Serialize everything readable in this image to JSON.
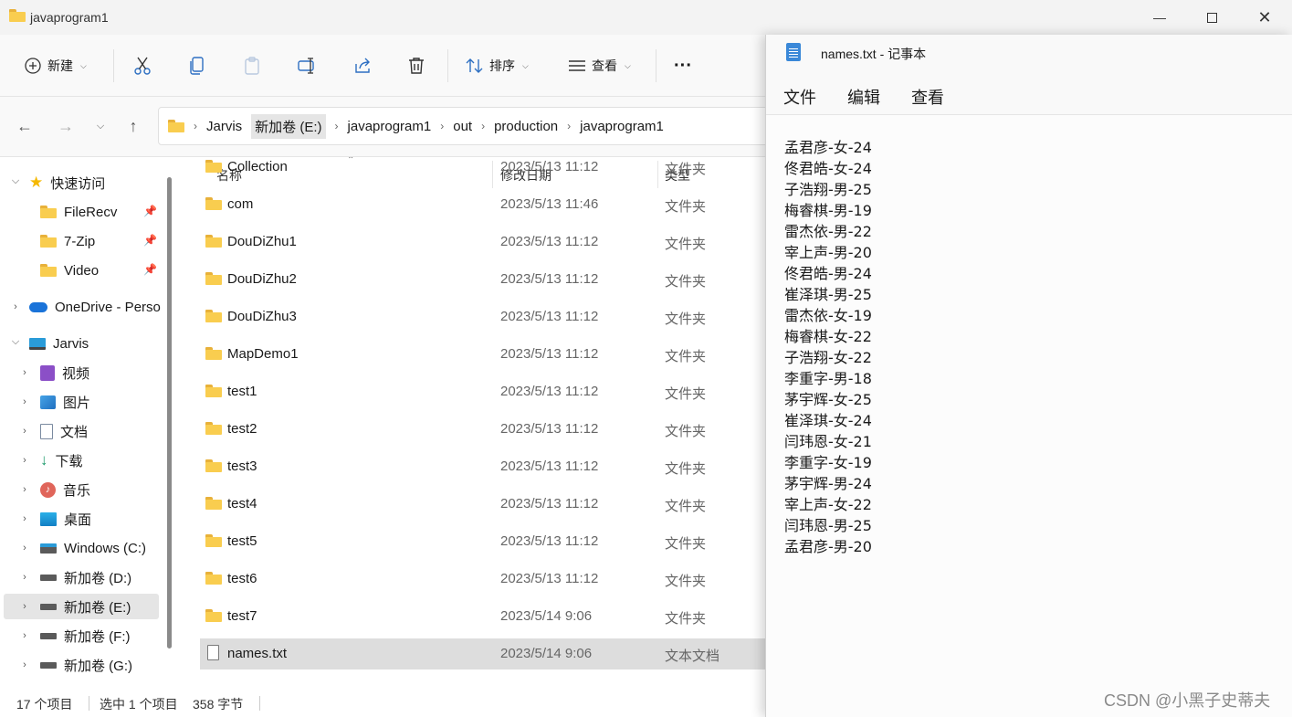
{
  "explorer": {
    "title": "javaprogram1",
    "toolbar": {
      "new_label": "新建",
      "sort_label": "排序",
      "view_label": "查看",
      "more_label": "···"
    },
    "breadcrumb": [
      "Jarvis",
      "新加卷 (E:)",
      "javaprogram1",
      "out",
      "production",
      "javaprogram1"
    ],
    "sidebar": {
      "quick_access": "快速访问",
      "pinned": [
        "FileRecv",
        "7-Zip",
        "Video"
      ],
      "onedrive": "OneDrive - Perso",
      "this_pc": "Jarvis",
      "pc_items": [
        "视频",
        "图片",
        "文档",
        "下载",
        "音乐",
        "桌面",
        "Windows (C:)",
        "新加卷 (D:)",
        "新加卷 (E:)",
        "新加卷 (F:)",
        "新加卷 (G:)"
      ]
    },
    "columns": {
      "name": "名称",
      "date": "修改日期",
      "type": "类型"
    },
    "files": [
      {
        "name": "Collection",
        "date": "2023/5/13 11:12",
        "type": "文件夹",
        "kind": "folder"
      },
      {
        "name": "com",
        "date": "2023/5/13 11:46",
        "type": "文件夹",
        "kind": "folder"
      },
      {
        "name": "DouDiZhu1",
        "date": "2023/5/13 11:12",
        "type": "文件夹",
        "kind": "folder"
      },
      {
        "name": "DouDiZhu2",
        "date": "2023/5/13 11:12",
        "type": "文件夹",
        "kind": "folder"
      },
      {
        "name": "DouDiZhu3",
        "date": "2023/5/13 11:12",
        "type": "文件夹",
        "kind": "folder"
      },
      {
        "name": "MapDemo1",
        "date": "2023/5/13 11:12",
        "type": "文件夹",
        "kind": "folder"
      },
      {
        "name": "test1",
        "date": "2023/5/13 11:12",
        "type": "文件夹",
        "kind": "folder"
      },
      {
        "name": "test2",
        "date": "2023/5/13 11:12",
        "type": "文件夹",
        "kind": "folder"
      },
      {
        "name": "test3",
        "date": "2023/5/13 11:12",
        "type": "文件夹",
        "kind": "folder"
      },
      {
        "name": "test4",
        "date": "2023/5/13 11:12",
        "type": "文件夹",
        "kind": "folder"
      },
      {
        "name": "test5",
        "date": "2023/5/13 11:12",
        "type": "文件夹",
        "kind": "folder"
      },
      {
        "name": "test6",
        "date": "2023/5/13 11:12",
        "type": "文件夹",
        "kind": "folder"
      },
      {
        "name": "test7",
        "date": "2023/5/14 9:06",
        "type": "文件夹",
        "kind": "folder"
      },
      {
        "name": "names.txt",
        "date": "2023/5/14 9:06",
        "type": "文本文档",
        "kind": "text"
      }
    ],
    "status": {
      "count": "17 个项目",
      "selected": "选中 1 个项目",
      "size": "358 字节"
    }
  },
  "notepad": {
    "title": "names.txt - 记事本",
    "menu": [
      "文件",
      "编辑",
      "查看"
    ],
    "lines": [
      "孟君彦-女-24",
      "佟君皓-女-24",
      "子浩翔-男-25",
      "梅睿棋-男-19",
      "雷杰依-男-22",
      "宰上声-男-20",
      "佟君皓-男-24",
      "崔泽琪-男-25",
      "雷杰依-女-19",
      "梅睿棋-女-22",
      "子浩翔-女-22",
      "李重字-男-18",
      "茅宇辉-女-25",
      "崔泽琪-女-24",
      "闫玮恩-女-21",
      "李重字-女-19",
      "茅宇辉-男-24",
      "宰上声-女-22",
      "闫玮恩-男-25",
      "孟君彦-男-20"
    ]
  },
  "watermark": "CSDN @小黑子史蒂夫"
}
